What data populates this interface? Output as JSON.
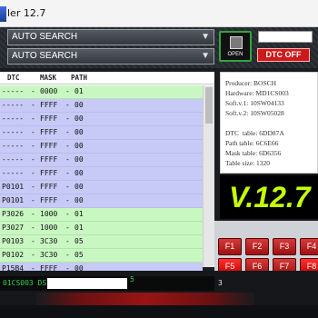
{
  "window": {
    "title": "ler 12.7"
  },
  "dropdowns": [
    {
      "value": "AUTO SEARCH"
    },
    {
      "value": "AUTO SEARCH"
    }
  ],
  "buttons": {
    "open": "OPEN",
    "dtc_off": "DTC OFF"
  },
  "table": {
    "headers": [
      "DTC",
      "MASK",
      "PATH"
    ],
    "rows": [
      {
        "dtc": "-----",
        "mask": "0000",
        "path": "01",
        "color": "green"
      },
      {
        "dtc": "-----",
        "mask": "FFFF",
        "path": "00",
        "color": "blue"
      },
      {
        "dtc": "-----",
        "mask": "FFFF",
        "path": "00",
        "color": "blue"
      },
      {
        "dtc": "-----",
        "mask": "FFFF",
        "path": "00",
        "color": "blue"
      },
      {
        "dtc": "-----",
        "mask": "FFFF",
        "path": "00",
        "color": "blue"
      },
      {
        "dtc": "-----",
        "mask": "FFFF",
        "path": "00",
        "color": "blue"
      },
      {
        "dtc": "-----",
        "mask": "FFFF",
        "path": "00",
        "color": "blue"
      },
      {
        "dtc": "P0101",
        "mask": "FFFF",
        "path": "00",
        "color": "blue"
      },
      {
        "dtc": "P0101",
        "mask": "FFFF",
        "path": "00",
        "color": "blue"
      },
      {
        "dtc": "P3026",
        "mask": "1000",
        "path": "01",
        "color": "green"
      },
      {
        "dtc": "P3027",
        "mask": "1000",
        "path": "01",
        "color": "green"
      },
      {
        "dtc": "P0103",
        "mask": "3C30",
        "path": "05",
        "color": "green"
      },
      {
        "dtc": "P0102",
        "mask": "3C30",
        "path": "05",
        "color": "green"
      },
      {
        "dtc": "P15B4",
        "mask": "FFFF",
        "path": "00",
        "color": "blue"
      }
    ]
  },
  "info": {
    "producer": "Producer: BOSCH",
    "hardware": "Hardware: MD1CS003",
    "soft1": "Soft.v.1: 10SW04133",
    "soft2": "Soft.v.2: 10SW05028",
    "dtc_table": "DTC  table: 6DD87A",
    "path_table": "Path table: 6C6E66",
    "mask_table": "Mask table: 6D6356",
    "table_size": "Table size: 1320"
  },
  "version": "V.12.7",
  "fkeys": [
    "F1",
    "F2",
    "F3",
    "F4",
    "F5",
    "F6",
    "F7",
    "F8"
  ],
  "status": {
    "ecu": "01CS003 DS7",
    "num": "5",
    "num3": "3"
  }
}
